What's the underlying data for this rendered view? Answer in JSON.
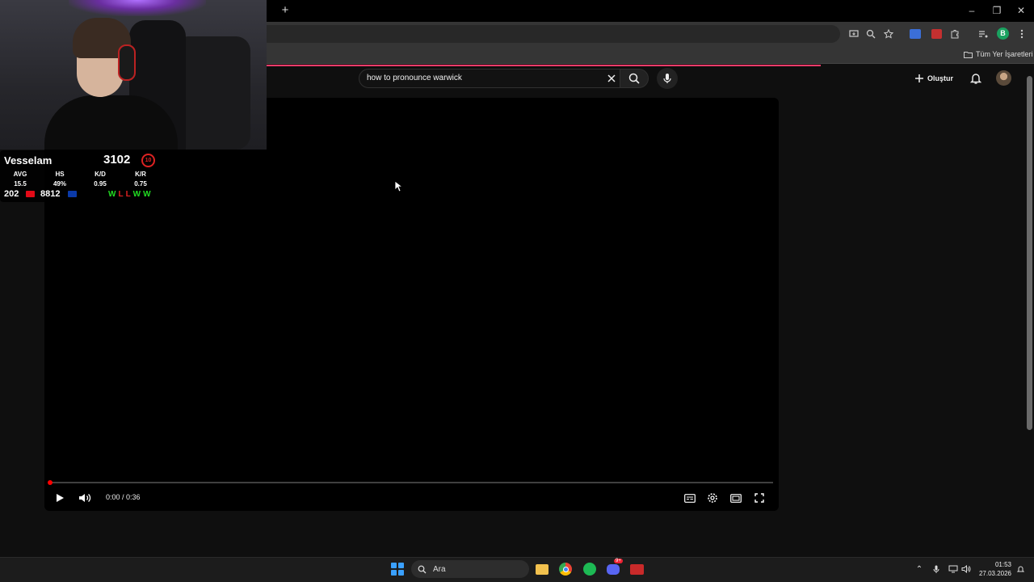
{
  "browser": {
    "new_tab_label": "+",
    "bookmark_all_label": "Tüm Yer İşaretleri",
    "profile_initial": "B"
  },
  "youtube": {
    "search": {
      "query": "how to pronounce warwick"
    },
    "create_label": "Oluştur",
    "player": {
      "time": "0:00 / 0:36",
      "progress_fraction": 0.0
    }
  },
  "overlay": {
    "player_name": "Vesselam",
    "elo": "3102",
    "level_badge": "10",
    "stats": [
      {
        "label": "AVG",
        "value": "15.5"
      },
      {
        "label": "HS",
        "value": "49%"
      },
      {
        "label": "K/D",
        "value": "0.95"
      },
      {
        "label": "K/R",
        "value": "0.75"
      }
    ],
    "rank_country": "202",
    "rank_region": "8812",
    "recent_results": [
      "W",
      "L",
      "L",
      "W",
      "W"
    ],
    "colors": {
      "win": "#22dd22",
      "loss": "#e02222"
    }
  },
  "taskbar": {
    "search_placeholder": "Ara",
    "time": "01:53",
    "date": "27.03.2026",
    "discord_badge": "9+"
  },
  "colors": {
    "yt_progress": "#ff3b6a",
    "player_dot": "#ff0000",
    "start_blue": "#3aa0ff"
  }
}
